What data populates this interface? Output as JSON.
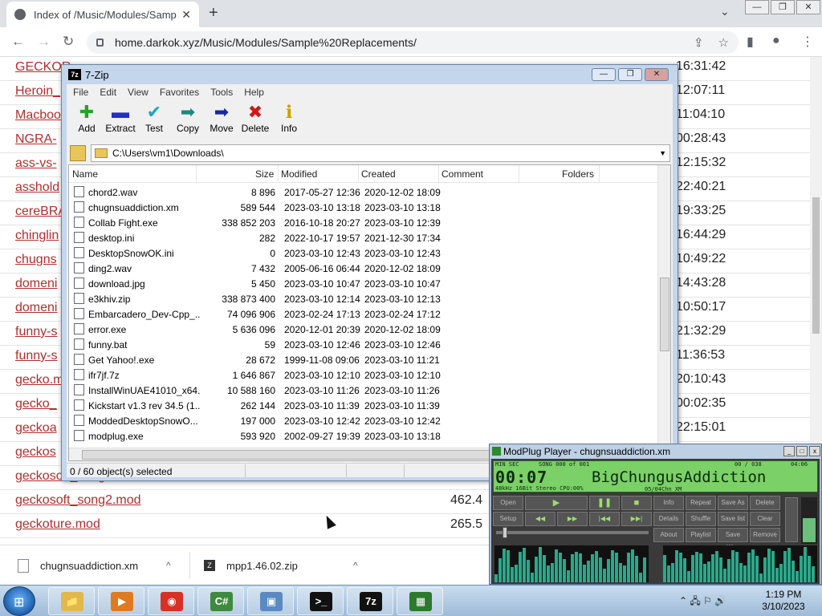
{
  "browser": {
    "tab_title": "Index of /Music/Modules/Sample Replacements",
    "tab_close": "✕",
    "new_tab": "+",
    "tab_search": "⌄",
    "url": "home.darkok.xyz/Music/Modules/Sample%20Replacements/",
    "back": "←",
    "forward": "→",
    "reload": "↻",
    "share": "⇪",
    "star": "☆",
    "sidepanel": "▮",
    "profile": "●",
    "menu": "⋮",
    "win_min": "—",
    "win_restore": "❐",
    "win_close": "✕"
  },
  "listing": [
    {
      "name": "GECKOR",
      "time": "16:31:42",
      "size": ""
    },
    {
      "name": "Heroin_",
      "time": "12:07:11",
      "size": ""
    },
    {
      "name": "Macboo",
      "time": "11:04:10",
      "size": ""
    },
    {
      "name": "NGRA-",
      "time": "00:28:43",
      "size": ""
    },
    {
      "name": "ass-vs-",
      "time": "12:15:32",
      "size": ""
    },
    {
      "name": "asshold",
      "time": "22:40:21",
      "size": ""
    },
    {
      "name": "cereBRA",
      "time": "19:33:25",
      "size": ""
    },
    {
      "name": "chinglin",
      "time": "16:44:29",
      "size": ""
    },
    {
      "name": "chugns",
      "time": "10:49:22",
      "size": ""
    },
    {
      "name": "domeni",
      "time": "14:43:28",
      "size": ""
    },
    {
      "name": "domeni",
      "time": "10:50:17",
      "size": ""
    },
    {
      "name": "funny-s",
      "time": "21:32:29",
      "size": ""
    },
    {
      "name": "funny-s",
      "time": "11:36:53",
      "size": ""
    },
    {
      "name": "gecko.m",
      "time": "20:10:43",
      "size": ""
    },
    {
      "name": "gecko_",
      "time": "00:02:35",
      "size": ""
    },
    {
      "name": "geckoa",
      "time": "22:15:01",
      "size": ""
    },
    {
      "name": "geckos",
      "time": "",
      "size": ""
    },
    {
      "name": "geckosoft_song1.mod",
      "time": "",
      "size": ""
    },
    {
      "name": "geckosoft_song2.mod",
      "time": "",
      "size": "462.4"
    },
    {
      "name": "geckoture.mod",
      "time": "",
      "size": "265.5"
    }
  ],
  "downloads": [
    {
      "name": "chugnsuaddiction.xm",
      "chev": "^"
    },
    {
      "name": "mpp1.46.02.zip",
      "chev": "^",
      "icon": "Z"
    }
  ],
  "sevenzip": {
    "title": "7-Zip",
    "icon": "7z",
    "menu": [
      "File",
      "Edit",
      "View",
      "Favorites",
      "Tools",
      "Help"
    ],
    "toolbar": [
      {
        "label": "Add",
        "glyph": "✚",
        "color": "#27a327"
      },
      {
        "label": "Extract",
        "glyph": "▬",
        "color": "#2330c0"
      },
      {
        "label": "Test",
        "glyph": "✔",
        "color": "#1aa8b8"
      },
      {
        "label": "Copy",
        "glyph": "➡",
        "color": "#1a8a7a"
      },
      {
        "label": "Move",
        "glyph": "➡",
        "color": "#1a2a9a"
      },
      {
        "label": "Delete",
        "glyph": "✖",
        "color": "#d01818"
      },
      {
        "label": "Info",
        "glyph": "ℹ",
        "color": "#c8a000"
      }
    ],
    "path": "C:\\Users\\vm1\\Downloads\\",
    "columns": {
      "name": "Name",
      "size": "Size",
      "modified": "Modified",
      "created": "Created",
      "comment": "Comment",
      "folders": "Folders"
    },
    "files": [
      {
        "name": "chord2.wav",
        "size": "8 896",
        "modified": "2017-05-27 12:36",
        "created": "2020-12-02 18:09"
      },
      {
        "name": "chugnsuaddiction.xm",
        "size": "589 544",
        "modified": "2023-03-10 13:18",
        "created": "2023-03-10 13:18"
      },
      {
        "name": "Collab Fight.exe",
        "size": "338 852 203",
        "modified": "2016-10-18 20:27",
        "created": "2023-03-10 12:39"
      },
      {
        "name": "desktop.ini",
        "size": "282",
        "modified": "2022-10-17 19:57",
        "created": "2021-12-30 17:34"
      },
      {
        "name": "DesktopSnowOK.ini",
        "size": "0",
        "modified": "2023-03-10 12:43",
        "created": "2023-03-10 12:43"
      },
      {
        "name": "ding2.wav",
        "size": "7 432",
        "modified": "2005-06-16 06:44",
        "created": "2020-12-02 18:09"
      },
      {
        "name": "download.jpg",
        "size": "5 450",
        "modified": "2023-03-10 10:47",
        "created": "2023-03-10 10:47"
      },
      {
        "name": "e3khiv.zip",
        "size": "338 873 400",
        "modified": "2023-03-10 12:14",
        "created": "2023-03-10 12:13"
      },
      {
        "name": "Embarcadero_Dev-Cpp_...",
        "size": "74 096 906",
        "modified": "2023-02-24 17:13",
        "created": "2023-02-24 17:12"
      },
      {
        "name": "error.exe",
        "size": "5 636 096",
        "modified": "2020-12-01 20:39",
        "created": "2020-12-02 18:09"
      },
      {
        "name": "funny.bat",
        "size": "59",
        "modified": "2023-03-10 12:46",
        "created": "2023-03-10 12:46"
      },
      {
        "name": "Get Yahoo!.exe",
        "size": "28 672",
        "modified": "1999-11-08 09:06",
        "created": "2023-03-10 11:21"
      },
      {
        "name": "ifr7jf.7z",
        "size": "1 646 867",
        "modified": "2023-03-10 12:10",
        "created": "2023-03-10 12:10"
      },
      {
        "name": "InstallWinUAE41010_x64...",
        "size": "10 588 160",
        "modified": "2023-03-10 11:26",
        "created": "2023-03-10 11:26"
      },
      {
        "name": "Kickstart v1.3 rev 34.5 (1...",
        "size": "262 144",
        "modified": "2023-03-10 11:39",
        "created": "2023-03-10 11:39"
      },
      {
        "name": "ModdedDesktopSnowO...",
        "size": "197 000",
        "modified": "2023-03-10 12:42",
        "created": "2023-03-10 12:42"
      },
      {
        "name": "modplug.exe",
        "size": "593 920",
        "modified": "2002-09-27 19:39",
        "created": "2023-03-10 13:18"
      }
    ],
    "status": "0 / 60 object(s) selected"
  },
  "modplug": {
    "title": "ModPlug Player - chugnsuaddiction.xm",
    "time": "00:07",
    "song_name": "BigChungusAddiction",
    "lcd_min_sec": "MIN SEC",
    "lcd_song": "SONG 000 of 001",
    "lcd_pos": "00 / 038",
    "lcd_right": "04:06",
    "lcd_info": "48kHz 16Bit Stereo CPU:00%",
    "lcd_chn": "05/04Chn XM",
    "buttons": {
      "open": "Open",
      "setup": "Setup",
      "play": "▶",
      "pause": "❚❚",
      "stop": "■",
      "rew": "◀◀",
      "ff": "▶▶",
      "prev": "|◀◀",
      "next": "▶▶|",
      "info": "Info",
      "repeat": "Repeat",
      "saveas": "Save As",
      "delete": "Delete",
      "details": "Details",
      "shuffle": "Shuffle",
      "savelist": "Save list",
      "clear": "Clear",
      "about": "About",
      "playlist": "Playlist",
      "savewav": "Save Wav",
      "remove": "Remove"
    }
  },
  "taskbar": {
    "start": "⊞",
    "apps": [
      {
        "name": "explorer",
        "glyph": "📁",
        "color": "#e2b84a"
      },
      {
        "name": "media",
        "glyph": "▶",
        "color": "#e07a20"
      },
      {
        "name": "chrome",
        "glyph": "◉",
        "color": "#d93025"
      },
      {
        "name": "csharp",
        "glyph": "C#",
        "color": "#3e8a3e"
      },
      {
        "name": "photo",
        "glyph": "▣",
        "color": "#5a8ac0"
      },
      {
        "name": "cmd",
        "glyph": ">_",
        "color": "#111111"
      },
      {
        "name": "7zip",
        "glyph": "7z",
        "color": "#111111"
      },
      {
        "name": "film",
        "glyph": "▦",
        "color": "#2c7a2c"
      }
    ],
    "tray": "⌃  🖧  ⚐  🔊",
    "time": "1:19 PM",
    "date": "3/10/2023"
  }
}
